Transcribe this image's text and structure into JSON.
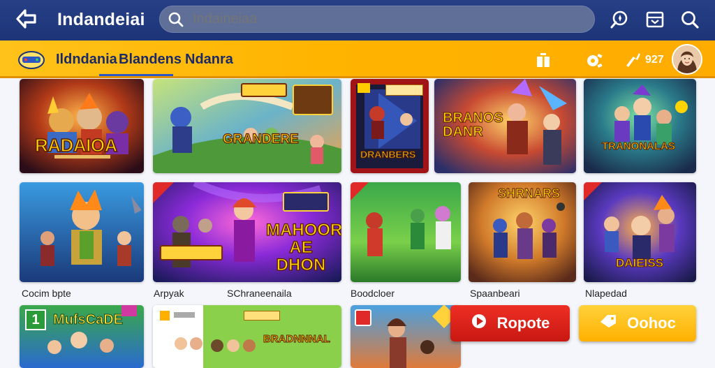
{
  "header": {
    "title": "Indandeiai",
    "search": {
      "value": "",
      "placeholder": "Indaineiaa"
    },
    "icons": [
      "back-arrow-icon",
      "search-icon",
      "explore-icon",
      "inbox-icon",
      "profile-search-icon"
    ]
  },
  "nav": {
    "tabs": [
      {
        "label": "Ildndania",
        "active": false
      },
      {
        "label": "Blandens",
        "active": true
      },
      {
        "label": "Ndanra",
        "active": false
      }
    ],
    "coins": "927",
    "icons": [
      "gift-icon",
      "gear-icon",
      "coin-icon"
    ]
  },
  "rows": [
    {
      "cards": [
        {
          "art_text": "RADAIOA",
          "title": ""
        },
        {
          "art_text": "GRANDERE",
          "title": ""
        },
        {
          "art_text": "DRANBERS",
          "title": ""
        },
        {
          "art_text": "BRANOS DANR",
          "title": ""
        },
        {
          "art_text": "TRANONALAS",
          "title": ""
        }
      ]
    },
    {
      "cards": [
        {
          "art_text": "",
          "title": "Cocim bpte"
        },
        {
          "art_text": "MAHOOR AE DHON",
          "title": "Arpyak"
        },
        {
          "art_text": "",
          "title": "Boodcloer"
        },
        {
          "art_text": "SHRNARS",
          "title": "Spaanbeari"
        },
        {
          "art_text": "DAIEISS",
          "title": "Nlapedad"
        }
      ]
    },
    {
      "cards": [
        {
          "art_text": "MufsCaDE",
          "title": ""
        },
        {
          "art_text": "BRADNNNAL",
          "title": ""
        },
        {
          "art_text": "",
          "title": ""
        }
      ]
    }
  ],
  "row2_extra_title": "SChraneenaila",
  "buttons": {
    "primary": {
      "label": "Ropote",
      "icon": "play-icon",
      "color": "#dd2218"
    },
    "secondary": {
      "label": "Oohoc",
      "icon": "coupon-icon",
      "color": "#ffc21a"
    }
  },
  "colors": {
    "header_bg": "#233b80",
    "nav_bg": "#ffb800",
    "accent": "#2a56c6"
  }
}
